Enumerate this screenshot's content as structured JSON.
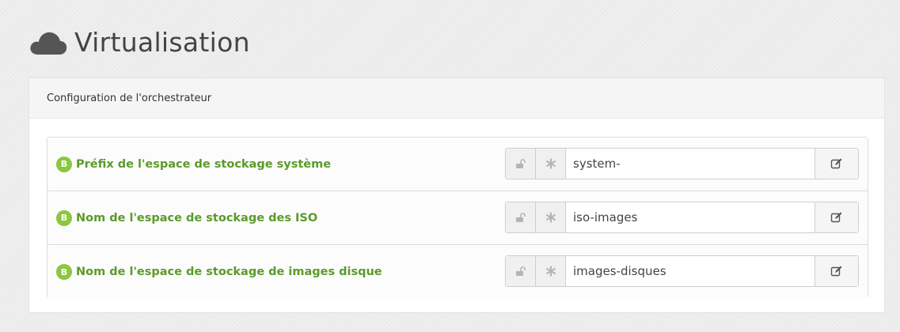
{
  "header": {
    "title": "Virtualisation",
    "icon": "cloud-icon"
  },
  "panel": {
    "heading": "Configuration de l'orchestrateur",
    "rows": [
      {
        "badge": "B",
        "label": "Préfix de l'espace de stockage système",
        "value": "system-"
      },
      {
        "badge": "B",
        "label": "Nom de l'espace de stockage des ISO",
        "value": "iso-images"
      },
      {
        "badge": "B",
        "label": "Nom de l'espace de stockage de images disque",
        "value": "images-disques"
      }
    ]
  },
  "colors": {
    "label_green": "#5c9a2a",
    "badge_green": "#8dc63f",
    "background": "#ebebeb"
  },
  "icons": {
    "lock": "unlock-icon",
    "required": "asterisk-icon",
    "edit": "edit-icon"
  }
}
